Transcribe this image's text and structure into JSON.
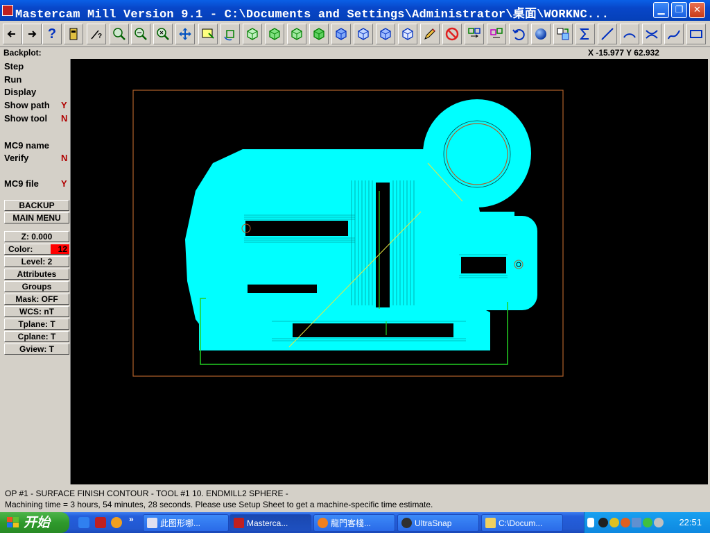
{
  "window": {
    "title": "Mastercam Mill Version 9.1 - C:\\Documents and Settings\\Administrator\\桌面\\WORKNC...",
    "minimize_label": "▁",
    "maximize_label": "❐",
    "close_label": "✕"
  },
  "toolbar": {
    "buttons": [
      "back",
      "forward",
      "help",
      "file-info",
      "query",
      "zoom-window",
      "zoom-out",
      "zoom-fit",
      "pan",
      "screen-select",
      "rotate",
      "view-top",
      "view-front",
      "view-side",
      "view-iso",
      "view-top-blue",
      "view-front-blue",
      "view-side-blue",
      "view-iso-blue",
      "pencil",
      "no-entry",
      "transform",
      "group",
      "undo",
      "sphere",
      "layers",
      "sum",
      "line",
      "arc",
      "trim",
      "spline",
      "rectangle"
    ],
    "help_label": "?"
  },
  "status": {
    "mode_label": "Backplot:",
    "coordinates": "X -15.977  Y 62.932"
  },
  "menu": {
    "step": "Step",
    "run": "Run",
    "display": "Display",
    "show_path": "Show path",
    "show_path_value": "Y",
    "show_tool": "Show tool",
    "show_tool_value": "N",
    "mc9_name": "MC9 name",
    "verify": "Verify",
    "verify_value": "N",
    "mc9_file": "MC9 file",
    "mc9_file_value": "Y",
    "backup": "BACKUP",
    "main_menu": "MAIN MENU"
  },
  "settings": {
    "z": "Z:   0.000",
    "color_label": "Color:",
    "color_value": "12",
    "level": "Level:  2",
    "attributes": "Attributes",
    "groups": "Groups",
    "mask": "Mask:  OFF",
    "wcs": "WCS:  nT",
    "tplane": "Tplane:  T",
    "cplane": "Cplane:  T",
    "gview": "Gview:  T"
  },
  "operation": {
    "line1": "OP #1 - SURFACE FINISH CONTOUR - TOOL #1 10. ENDMILL2 SPHERE -",
    "line2": "Machining time = 3 hours, 54 minutes, 28 seconds. Please use Setup Sheet to get a machine-specific time estimate."
  },
  "taskbar": {
    "start_label": "开始",
    "tasks": [
      "此图形哪...",
      "Masterca...",
      "龍門客棧...",
      "UltraSnap",
      "C:\\Docum..."
    ],
    "clock": "22:51",
    "expand_label": "»"
  },
  "colors": {
    "toolpath": "#00ffff",
    "stock_boundary": "#b0602a",
    "containment": "#22d022",
    "background": "#000000"
  }
}
